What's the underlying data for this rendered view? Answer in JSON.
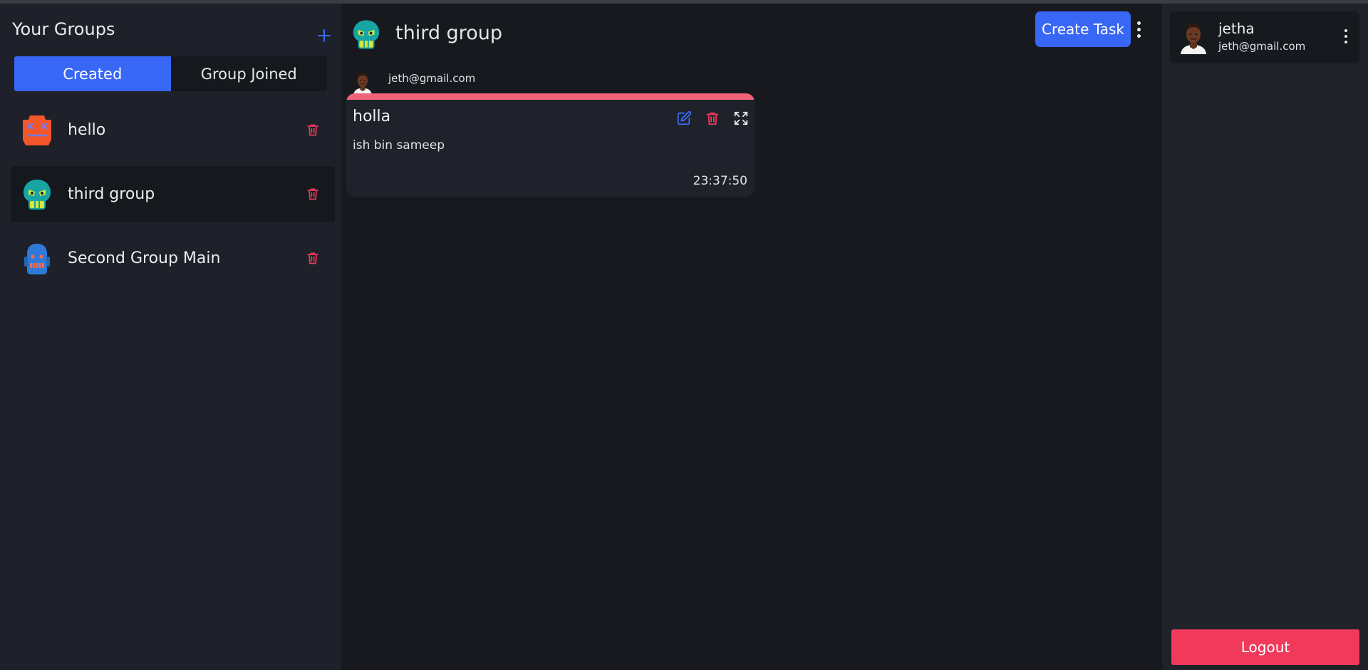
{
  "sidebar": {
    "title": "Your Groups",
    "add_icon": "plus-icon",
    "tabs": [
      {
        "label": "Created",
        "active": true
      },
      {
        "label": "Group Joined",
        "active": false
      }
    ],
    "groups": [
      {
        "name": "hello",
        "icon": "orange-robot-avatar",
        "selected": false
      },
      {
        "name": "third group",
        "icon": "teal-skull-avatar",
        "selected": true
      },
      {
        "name": "Second Group Main",
        "icon": "blue-robot-avatar",
        "selected": false
      }
    ],
    "delete_icon": "trash-icon"
  },
  "main": {
    "group_title": "third group",
    "create_task_label": "Create Task",
    "tasks": [
      {
        "author_email": "jeth@gmail.com",
        "title": "holla",
        "description": "ish bin sameep",
        "time": "23:37:50",
        "strip_color": "#f0637b"
      }
    ]
  },
  "user": {
    "name": "jetha",
    "email": "jeth@gmail.com",
    "logout_label": "Logout"
  },
  "colors": {
    "accent": "#3866f5",
    "danger": "#f0395b",
    "background": "#17191e",
    "panel": "#1e2129"
  }
}
